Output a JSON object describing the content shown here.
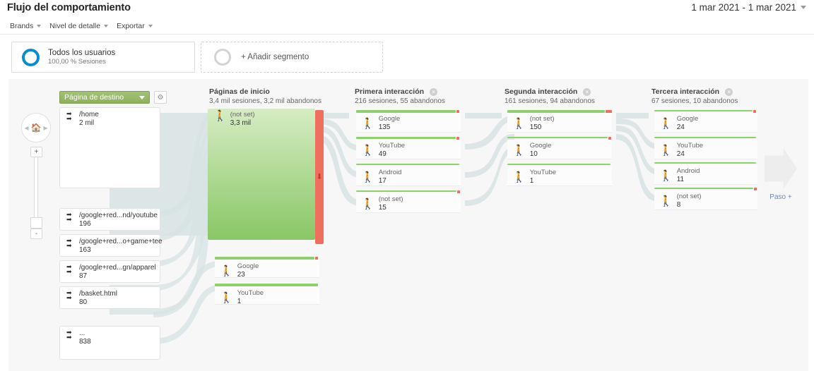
{
  "header": {
    "title": "Flujo del comportamiento",
    "date_range": "1 mar 2021 - 1 mar 2021",
    "date_caret_icon": "chevron-down-icon"
  },
  "toolbar": {
    "items": [
      {
        "label": "Brands",
        "caret_icon": "chevron-down-icon"
      },
      {
        "label": "Nivel de detalle",
        "caret_icon": "chevron-down-icon"
      },
      {
        "label": "Exportar",
        "caret_icon": "chevron-down-icon"
      }
    ]
  },
  "segments": {
    "all_users": {
      "name": "Todos los usuarios",
      "detail": "100,00 % Sesiones",
      "ring_color": "#0b8bd0"
    },
    "add_segment": {
      "label": "+ Añadir segmento"
    }
  },
  "flow": {
    "dimension_selector": {
      "label": "Página de destino",
      "caret_icon": "chevron-down-icon",
      "color": "#97b869"
    },
    "settings_icon": "gear-icon",
    "nav": {
      "home_icon": "home-icon",
      "prev_icon": "chevron-left-icon",
      "next_icon": "chevron-right-icon",
      "zoom_in": "+",
      "zoom_out": "-"
    },
    "step_plus": {
      "label": "Paso +",
      "icon": "arrow-right-icon"
    },
    "columns": [
      {
        "title": "Páginas de inicio",
        "subtitle": "3,4 mil sesiones, 3,2 mil abandonos",
        "closable": false
      },
      {
        "title": "Primera interacción",
        "subtitle": "216 sesiones, 55 abandonos",
        "closable": true,
        "close_icon": "close-icon"
      },
      {
        "title": "Segunda interacción",
        "subtitle": "161 sesiones, 94 abandonos",
        "closable": true,
        "close_icon": "close-icon"
      },
      {
        "title": "Tercera interacción",
        "subtitle": "67 sesiones, 10 abandonos",
        "closable": true,
        "close_icon": "close-icon"
      }
    ],
    "landing_pages": [
      {
        "name": "/home",
        "value": "2 mil",
        "icon": "arrows-right-icon"
      },
      {
        "name": "/google+red...nd/youtube",
        "value": "196",
        "icon": "arrows-right-icon"
      },
      {
        "name": "/google+red...o+game+tee",
        "value": "163",
        "icon": "arrows-right-icon"
      },
      {
        "name": "/google+red...gn/apparel",
        "value": "87",
        "icon": "arrows-right-icon"
      },
      {
        "name": "/basket.html",
        "value": "80",
        "icon": "arrows-right-icon"
      },
      {
        "name": "...",
        "value": "838",
        "icon": "arrows-right-icon"
      }
    ],
    "start_pages_nodes": [
      {
        "name": "(not set)",
        "value": "3,3 mil",
        "icon": "walking-icon",
        "drop_icon": "arrow-down-icon"
      },
      {
        "name": "Google",
        "value": "23",
        "icon": "walking-icon"
      },
      {
        "name": "YouTube",
        "value": "1",
        "icon": "walking-icon"
      }
    ],
    "first_interaction_nodes": [
      {
        "name": "Google",
        "value": "135",
        "icon": "walking-icon"
      },
      {
        "name": "YouTube",
        "value": "49",
        "icon": "walking-icon"
      },
      {
        "name": "Android",
        "value": "17",
        "icon": "walking-icon"
      },
      {
        "name": "(not set)",
        "value": "15",
        "icon": "walking-icon"
      }
    ],
    "second_interaction_nodes": [
      {
        "name": "(not set)",
        "value": "150",
        "icon": "walking-icon"
      },
      {
        "name": "Google",
        "value": "10",
        "icon": "walking-icon"
      },
      {
        "name": "YouTube",
        "value": "1",
        "icon": "walking-icon"
      }
    ],
    "third_interaction_nodes": [
      {
        "name": "Google",
        "value": "24",
        "icon": "walking-icon"
      },
      {
        "name": "YouTube",
        "value": "24",
        "icon": "walking-icon"
      },
      {
        "name": "Android",
        "value": "11",
        "icon": "walking-icon"
      },
      {
        "name": "(not set)",
        "value": "8",
        "icon": "walking-icon"
      }
    ],
    "colors": {
      "node_green": "#8ecf6e",
      "dropoff_red": "#ee6f5e",
      "ribbon": "#d6e2e2",
      "canvas_bg": "#f7f7f7"
    }
  }
}
